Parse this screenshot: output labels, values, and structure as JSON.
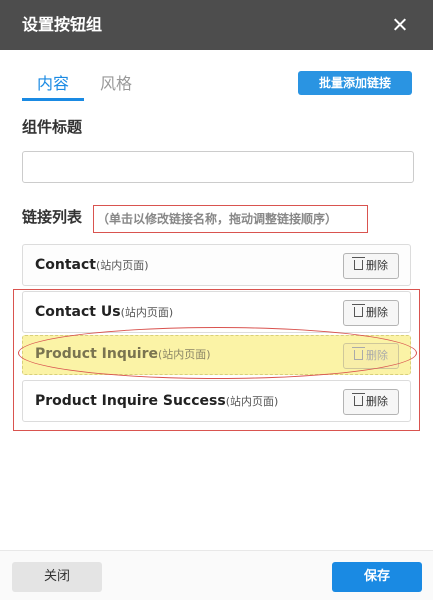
{
  "dialog": {
    "title": "设置按钮组"
  },
  "tabs": [
    {
      "label": "内容",
      "active": true
    },
    {
      "label": "风格",
      "active": false
    }
  ],
  "batch_add_label": "批量添加链接",
  "component_title": {
    "label": "组件标题",
    "value": "",
    "placeholder": ""
  },
  "link_list": {
    "label": "链接列表",
    "hint": "（单击以修改链接名称，拖动调整链接顺序）",
    "delete_label": "删除",
    "items": [
      {
        "name": "Contact",
        "type": "(站内页面)"
      },
      {
        "name": "Contact Us",
        "type": "(站内页面)"
      },
      {
        "name": "Product Inquire",
        "type": "(站内页面)",
        "dragging": true
      },
      {
        "name": "Product Inquire Success",
        "type": "(站内页面)"
      }
    ]
  },
  "footer": {
    "close_label": "关闭",
    "save_label": "保存"
  },
  "colors": {
    "header_bg": "#4d4d4d",
    "accent": "#1a8ae3",
    "annotation": "#d9534f",
    "drag_highlight": "#fbf3a6"
  }
}
